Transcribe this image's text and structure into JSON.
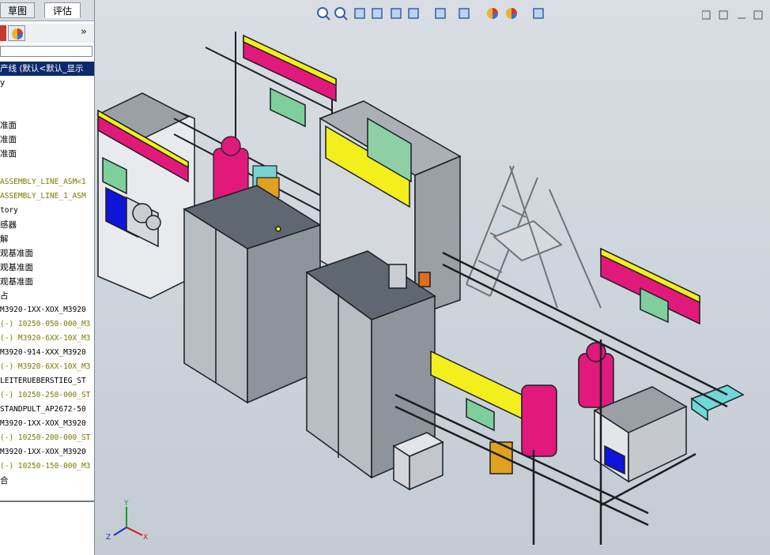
{
  "panel": {
    "tabs": [
      {
        "label": "草图"
      },
      {
        "label": "评估"
      }
    ],
    "filter_placeholder": "",
    "expand_label": "»",
    "tree": [
      {
        "text": "产线 (默认<默认_显示",
        "style": "sel"
      },
      {
        "text": "y",
        "style": ""
      },
      {
        "text": "",
        "style": ""
      },
      {
        "text": "",
        "style": ""
      },
      {
        "text": "准面",
        "style": ""
      },
      {
        "text": "准面",
        "style": ""
      },
      {
        "text": "准面",
        "style": ""
      },
      {
        "text": "",
        "style": ""
      },
      {
        "text": " ASSEMBLY_LINE_ASM<1",
        "style": "mono olive"
      },
      {
        "text": " ASSEMBLY_LINE_1_ASM",
        "style": "mono olive"
      },
      {
        "text": "tory",
        "style": "mono"
      },
      {
        "text": "感器",
        "style": ""
      },
      {
        "text": "解",
        "style": ""
      },
      {
        "text": "观基准面",
        "style": ""
      },
      {
        "text": "观基准面",
        "style": ""
      },
      {
        "text": "观基准面",
        "style": ""
      },
      {
        "text": "占",
        "style": ""
      },
      {
        "text": " M3920-1XX-XOX_M3920",
        "style": "mono"
      },
      {
        "text": "(-) 10250-050-000_M3",
        "style": "mono olive"
      },
      {
        "text": "(-) M3920-6XX-10X_M3",
        "style": "mono olive"
      },
      {
        "text": " M3920-914-XXX_M3920",
        "style": "mono"
      },
      {
        "text": "(-) M3920-6XX-10X_M3",
        "style": "mono olive"
      },
      {
        "text": " LEITERUEBERSTIEG_ST",
        "style": "mono"
      },
      {
        "text": "(-) 10250-250-000_ST",
        "style": "mono olive"
      },
      {
        "text": " STANDPULT_AP2672-50",
        "style": "mono"
      },
      {
        "text": " M3920-1XX-XOX_M3920",
        "style": "mono"
      },
      {
        "text": "(-) 10250-200-000_ST",
        "style": "mono olive"
      },
      {
        "text": " M3920-1XX-XOX_M3920",
        "style": "mono"
      },
      {
        "text": "(-) 10250-150-000_M3",
        "style": "mono olive"
      },
      {
        "text": "合",
        "style": ""
      }
    ]
  },
  "graphics": {
    "toolbar_icons": [
      "zoom-to-fit-icon",
      "zoom-area-icon",
      "previous-view-icon",
      "section-view-icon",
      "dynamic-annotation-icon",
      "view-orientation-icon",
      "display-style-icon",
      "hide-show-icon",
      "edit-appearance-icon",
      "apply-scene-icon",
      "view-settings-icon"
    ],
    "triad": {
      "x": "X",
      "y": "Y",
      "z": "Z"
    },
    "colors": {
      "magenta": "#e0197a",
      "yellow": "#f2ef1c",
      "green": "#7ecf9b",
      "gray": "#9aa0a6",
      "teal": "#6fd9d6"
    }
  }
}
